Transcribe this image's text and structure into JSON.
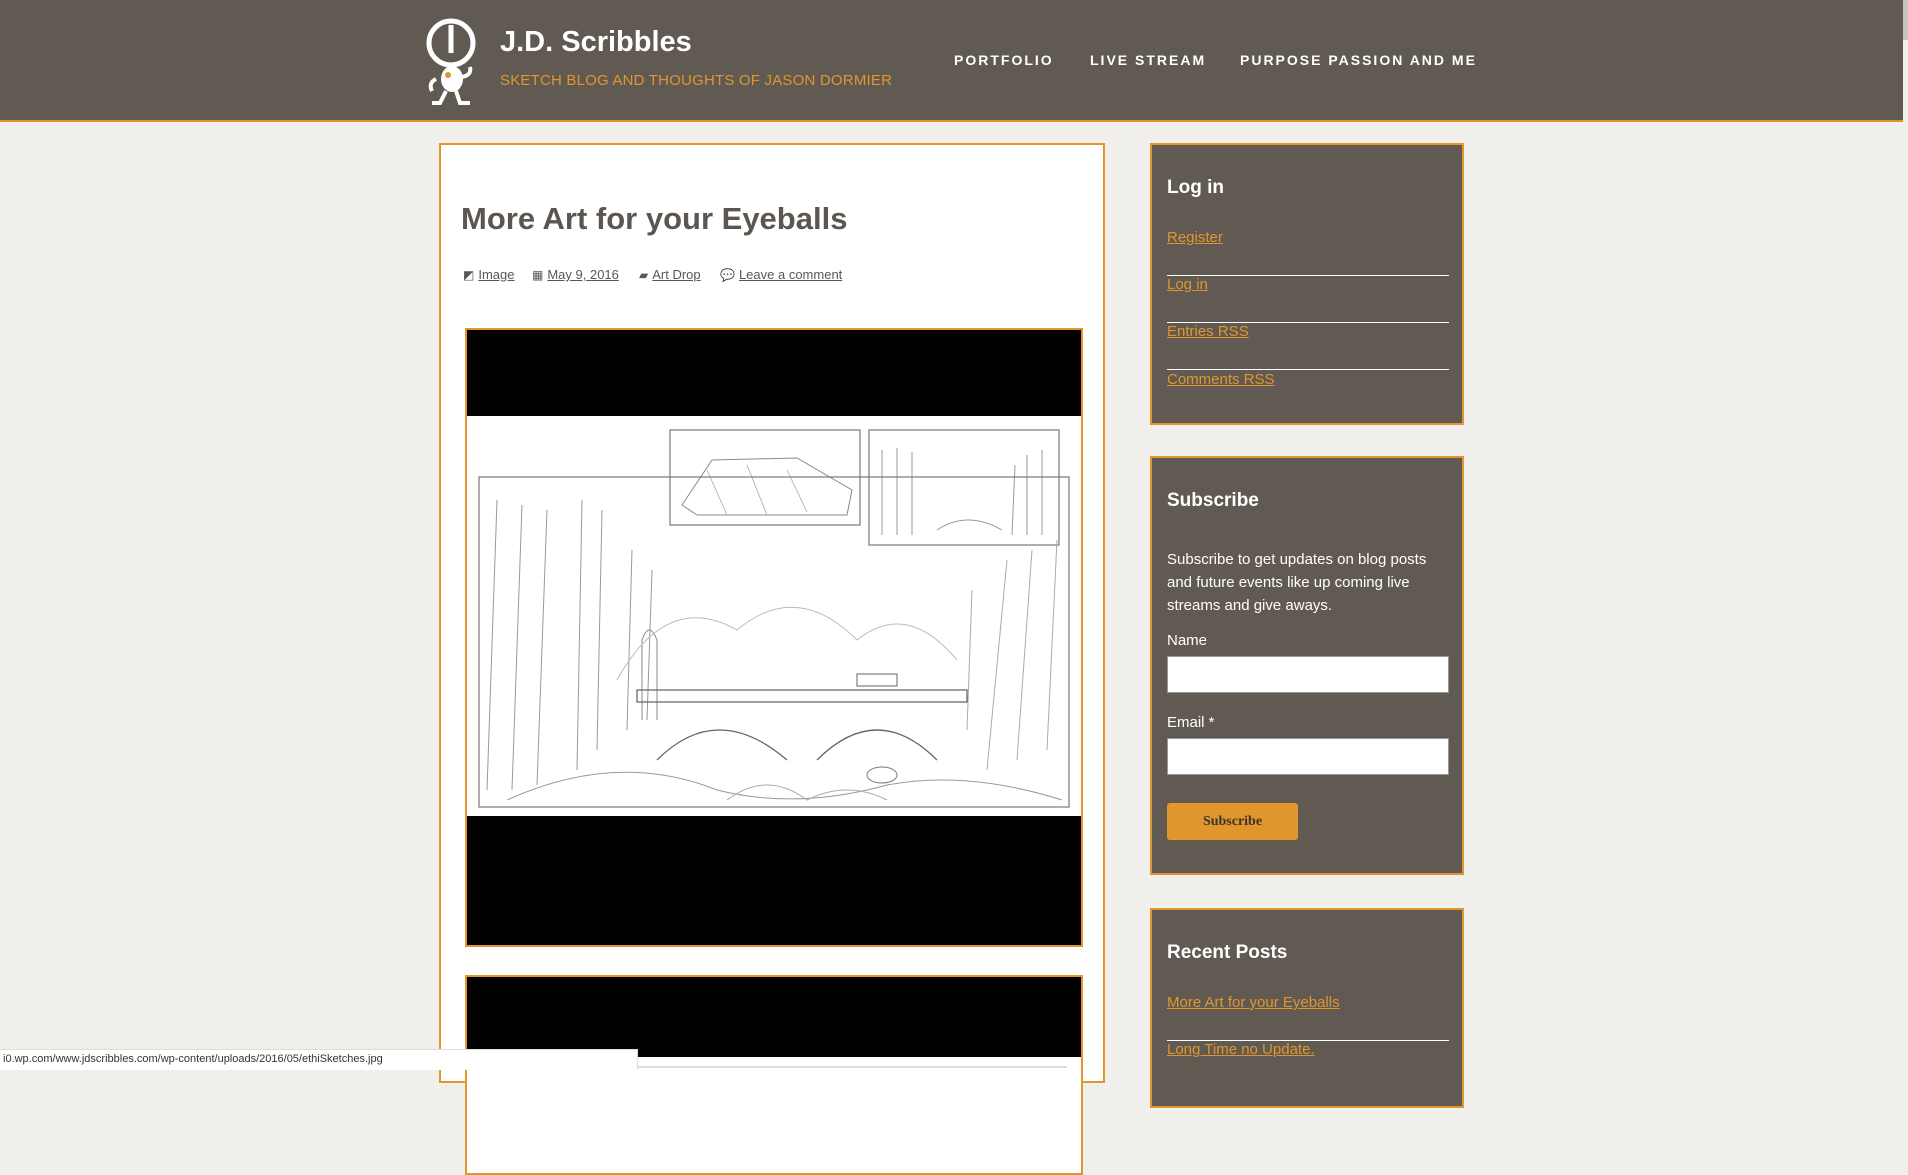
{
  "header": {
    "title": "J.D. Scribbles",
    "tagline": "SKETCH BLOG AND THOUGHTS OF JASON DORMIER",
    "nav": [
      "PORTFOLIO",
      "LIVE STREAM",
      "PURPOSE PASSION AND ME"
    ]
  },
  "post": {
    "title": "More Art for your Eyeballs",
    "meta": {
      "format": "Image",
      "date": "May 9, 2016",
      "category": "Art Drop",
      "comments": "Leave a comment"
    }
  },
  "sidebar": {
    "login": {
      "title": "Log in",
      "links": [
        "Register",
        "Log in",
        "Entries RSS",
        "Comments RSS"
      ]
    },
    "subscribe": {
      "title": "Subscribe",
      "text": "Subscribe to get updates on blog posts and future events like up coming live streams and give aways.",
      "name_label": "Name",
      "email_label": "Email *",
      "button": "Subscribe"
    },
    "recent": {
      "title": "Recent Posts",
      "links": [
        "More Art for your Eyeballs",
        "Long Time no Update."
      ]
    }
  },
  "statusbar": {
    "url": "i0.wp.com/www.jdscribbles.com/wp-content/uploads/2016/05/ethiSketches.jpg"
  },
  "colors": {
    "header_bg": "#615a52",
    "accent": "#e0962d",
    "page_bg": "#f1efec"
  }
}
